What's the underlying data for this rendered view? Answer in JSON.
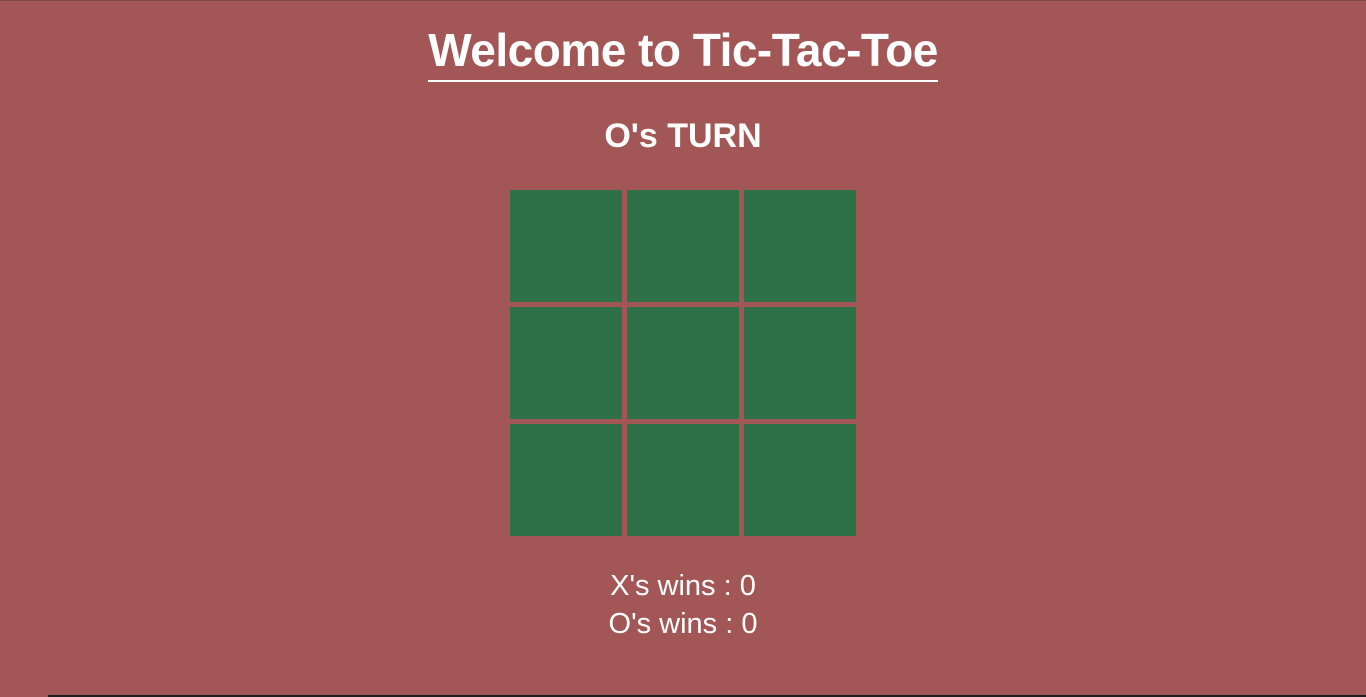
{
  "title": "Welcome to Tic-Tac-Toe",
  "status": {
    "turn_text": "O's TURN"
  },
  "board": {
    "cells": [
      "",
      "",
      "",
      "",
      "",
      "",
      "",
      "",
      ""
    ]
  },
  "scores": {
    "x_wins": "X's wins : 0",
    "o_wins": "O's wins : 0"
  },
  "colors": {
    "background": "#a35656",
    "cell": "#2e7048",
    "text": "#ffffff"
  }
}
